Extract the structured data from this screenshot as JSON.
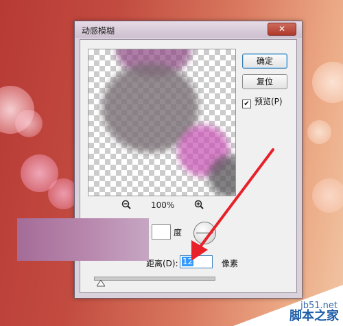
{
  "dialog": {
    "title": "动感模糊",
    "close_label": "✕"
  },
  "buttons": {
    "ok": "确定",
    "reset": "复位"
  },
  "preview_option": {
    "label": "预览(P)",
    "checked": true
  },
  "zoom": {
    "value": "100%",
    "zoom_out_icon": "zoom-out-icon",
    "zoom_in_icon": "zoom-in-icon"
  },
  "angle": {
    "unit": "度"
  },
  "distance": {
    "label": "距离(D):",
    "value": "12",
    "unit": "像素"
  },
  "watermark": {
    "site": "jb51.net",
    "brand": "脚本之家"
  },
  "colors": {
    "arrow": "#e8202a",
    "selection": "#3399ff"
  }
}
